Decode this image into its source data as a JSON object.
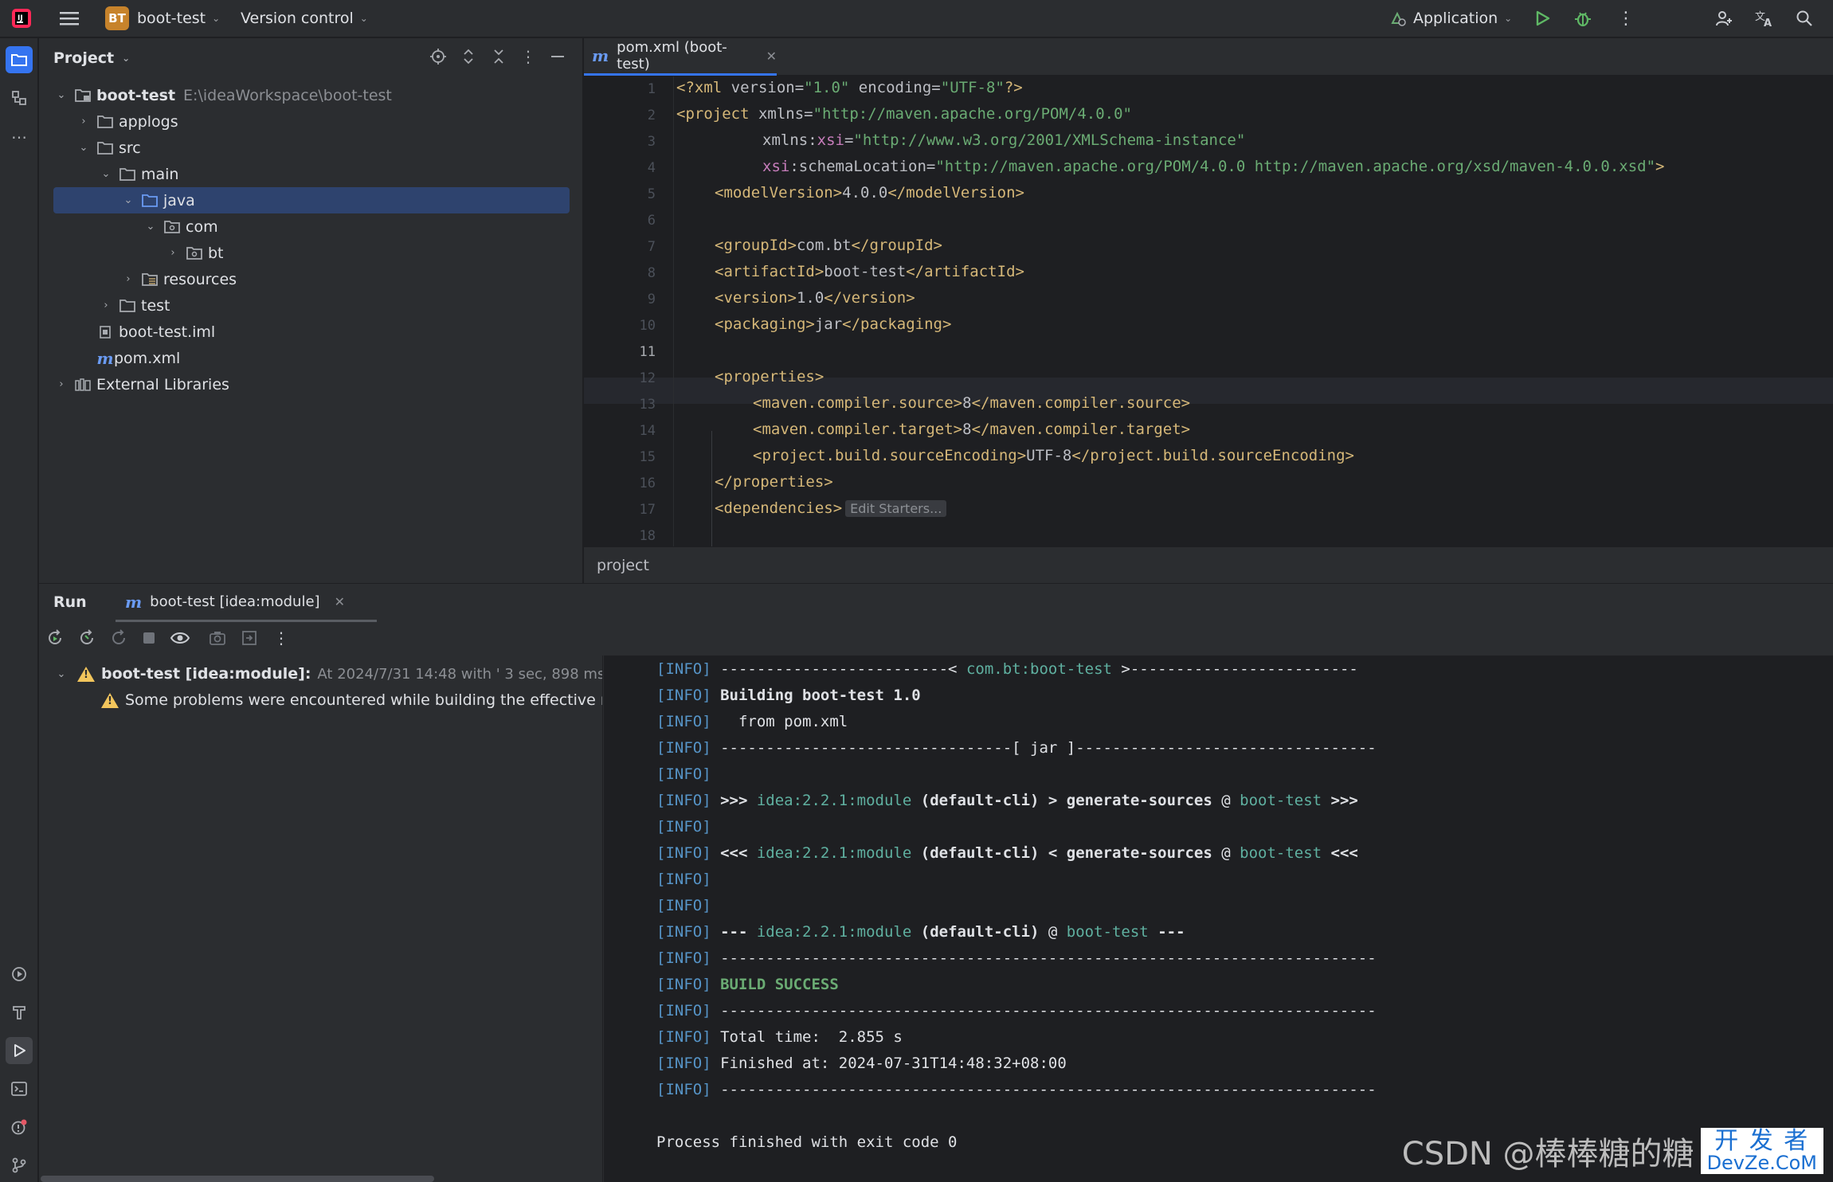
{
  "titlebar": {
    "project_badge": "BT",
    "project_name": "boot-test",
    "vcs": "Version control",
    "run_config": "Application"
  },
  "project_panel": {
    "title": "Project",
    "root_name": "boot-test",
    "root_path": "E:\\ideaWorkspace\\boot-test",
    "items": [
      {
        "label": "applogs"
      },
      {
        "label": "src"
      },
      {
        "label": "main"
      },
      {
        "label": "java"
      },
      {
        "label": "com"
      },
      {
        "label": "bt"
      },
      {
        "label": "resources"
      },
      {
        "label": "test"
      },
      {
        "label": "boot-test.iml"
      },
      {
        "label": "pom.xml"
      },
      {
        "label": "External Libraries"
      }
    ]
  },
  "editor": {
    "tab_label": "pom.xml (boot-test)",
    "breadcrumb": "project",
    "hint": "Edit Starters...",
    "line_numbers": [
      "1",
      "2",
      "3",
      "4",
      "5",
      "6",
      "7",
      "8",
      "9",
      "10",
      "11",
      "12",
      "13",
      "14",
      "15",
      "16",
      "17",
      "18"
    ],
    "code": {
      "l1_pi": "<?xml",
      "l1_a1": " version=",
      "l1_v1": "\"1.0\"",
      "l1_a2": " encoding=",
      "l1_v2": "\"UTF-8\"",
      "l1_end": "?>",
      "l2_tag": "<project",
      "l2_attr": " xmlns=",
      "l2_val": "\"http://maven.apache.org/POM/4.0.0\"",
      "l3_a": "xmlns:",
      "l3_ns": "xsi",
      "l3_eq": "=",
      "l3_val": "\"http://www.w3.org/2001/XMLSchema-instance\"",
      "l4_ns": "xsi",
      "l4_a": ":schemaLocation=",
      "l4_val": "\"http://maven.apache.org/POM/4.0.0 http://maven.apache.org/xsd/maven-4.0.0.xsd\"",
      "l4_end": ">",
      "l5_open": "<modelVersion>",
      "l5_txt": "4.0.0",
      "l5_close": "</modelVersion>",
      "l7_open": "<groupId>",
      "l7_txt": "com.bt",
      "l7_close": "</groupId>",
      "l8_open": "<artifactId>",
      "l8_txt": "boot-test",
      "l8_close": "</artifactId>",
      "l9_open": "<version>",
      "l9_txt": "1.0",
      "l9_close": "</version>",
      "l10_open": "<packaging>",
      "l10_txt": "jar",
      "l10_close": "</packaging>",
      "l12": "<properties>",
      "l13_open": "<maven.compiler.source>",
      "l13_txt": "8",
      "l13_close": "</maven.compiler.source>",
      "l14_open": "<maven.compiler.target>",
      "l14_txt": "8",
      "l14_close": "</maven.compiler.target>",
      "l15_open": "<project.build.sourceEncoding>",
      "l15_txt": "UTF-8",
      "l15_close": "</project.build.sourceEncoding>",
      "l16": "</properties>",
      "l17": "<dependencies>"
    }
  },
  "run_panel": {
    "title": "Run",
    "tab_label": "boot-test [idea:module]",
    "tree_root": "boot-test [idea:module]:",
    "tree_root_meta": "At 2024/7/31 14:48 with ' 3 sec, 898 ms",
    "tree_child": "Some problems were encountered while building the effective mo"
  },
  "console": {
    "info": "[INFO]",
    "l1_a": " -------------------------< ",
    "l1_b": "com.bt:boot-test",
    "l1_c": " >-------------------------",
    "l2": " Building boot-test 1.0",
    "l3": "   from pom.xml",
    "l4": " --------------------------------[ jar ]---------------------------------",
    "l6_a": " >>> ",
    "l6_b": "idea:2.2.1:module",
    "l6_c": " (default-cli) > generate-sources",
    "l6_d": " @ ",
    "l6_e": "boot-test",
    "l6_f": " >>>",
    "l8_a": " <<< ",
    "l8_b": "idea:2.2.1:module",
    "l8_c": " (default-cli) < generate-sources",
    "l8_d": " @ ",
    "l8_e": "boot-test",
    "l8_f": " <<<",
    "l11_a": " --- ",
    "l11_b": "idea:2.2.1:module",
    "l11_c": " (default-cli)",
    "l11_d": " @ ",
    "l11_e": "boot-test",
    "l11_f": " ---",
    "sep": " ------------------------------------------------------------------------",
    "success": " BUILD SUCCESS",
    "total": " Total time:  2.855 s",
    "finished": " Finished at: 2024-07-31T14:48:32+08:00",
    "exit": "Process finished with exit code 0"
  },
  "watermark": {
    "text": "CSDN @棒棒糖的糖",
    "logo_top": "开 发 者",
    "logo_bottom": "DevZe.CoM"
  }
}
